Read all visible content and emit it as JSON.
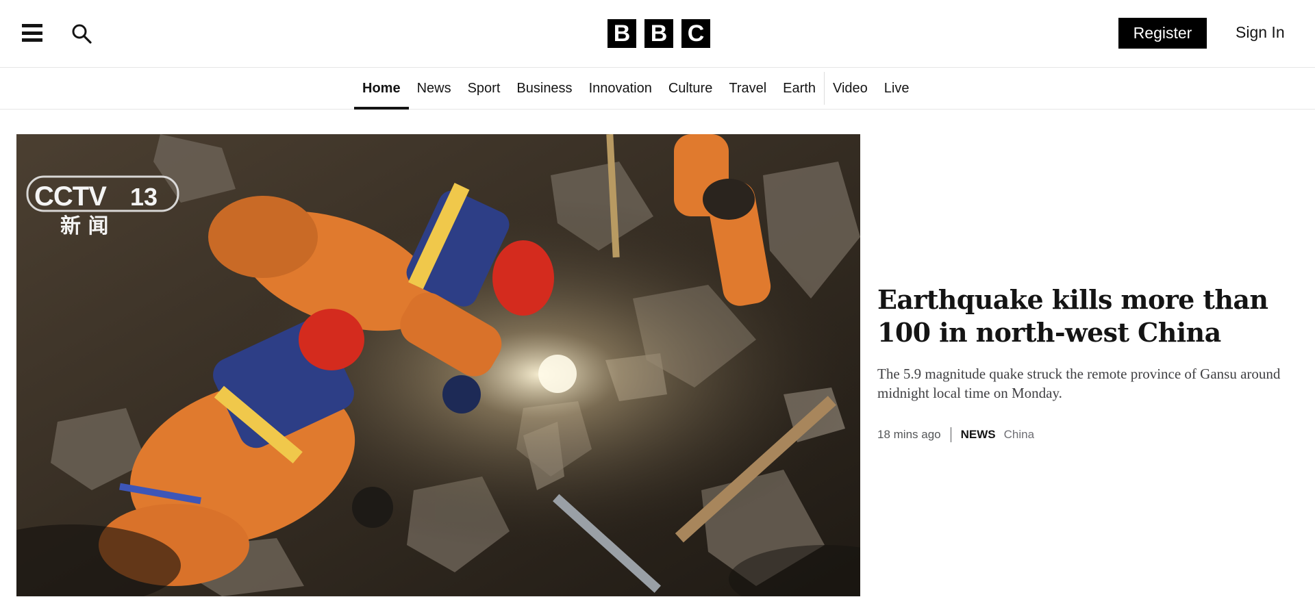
{
  "header": {
    "menu_icon": "hamburger-menu-icon",
    "search_icon": "search-icon",
    "logo_letters": [
      "B",
      "B",
      "C"
    ],
    "register_label": "Register",
    "signin_label": "Sign In"
  },
  "nav": {
    "items": [
      {
        "label": "Home",
        "active": true
      },
      {
        "label": "News",
        "active": false
      },
      {
        "label": "Sport",
        "active": false
      },
      {
        "label": "Business",
        "active": false
      },
      {
        "label": "Innovation",
        "active": false
      },
      {
        "label": "Culture",
        "active": false
      },
      {
        "label": "Travel",
        "active": false
      },
      {
        "label": "Earth",
        "active": false
      },
      {
        "label": "Video",
        "active": false
      },
      {
        "label": "Live",
        "active": false
      }
    ]
  },
  "hero": {
    "image_overlay": {
      "channel_logo": "CCTV",
      "channel_number": "13",
      "channel_subtitle": "新 闻"
    },
    "headline": "Earthquake kills more than 100 in north-west China",
    "summary": "The 5.9 magnitude quake struck the remote province of Gansu around midnight local time on Monday.",
    "meta": {
      "time": "18 mins ago",
      "section": "NEWS",
      "topic": "China"
    }
  },
  "colors": {
    "brand_black": "#000000",
    "text": "#141414",
    "muted": "#545658",
    "rescuer_orange": "#e07a2e",
    "helmet_red": "#d42b1e"
  }
}
